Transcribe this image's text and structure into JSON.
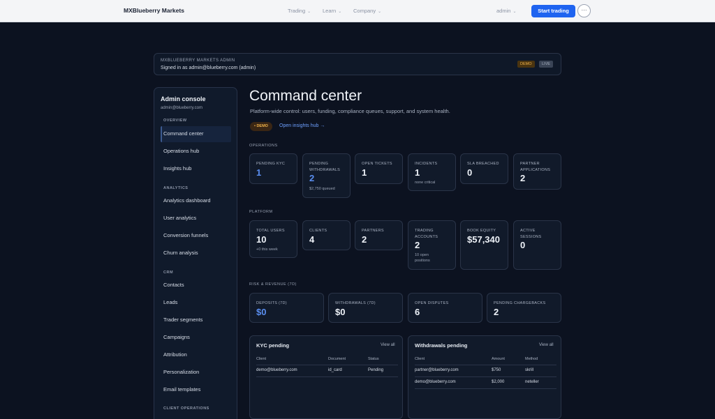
{
  "nav": {
    "brand": "MXBlueberry Markets",
    "links": [
      "Trading",
      "Learn",
      "Company"
    ],
    "user": "admin",
    "cta": "Start trading",
    "more": "···"
  },
  "banner": {
    "kicker": "MXBLUEBERRY MARKETS ADMIN",
    "signed_in": "Signed in as admin@blueberry.com (admin)",
    "demo_badge": "DEMO",
    "live_badge": "LIVE"
  },
  "sidebar": {
    "title": "Admin console",
    "email": "admin@blueberry.com",
    "sections": [
      {
        "label": "OVERVIEW",
        "items": [
          "Command center",
          "Operations hub",
          "Insights hub"
        ]
      },
      {
        "label": "ANALYTICS",
        "items": [
          "Analytics dashboard",
          "User analytics",
          "Conversion funnels",
          "Churn analysis"
        ]
      },
      {
        "label": "CRM",
        "items": [
          "Contacts",
          "Leads",
          "Trader segments",
          "Campaigns",
          "Attribution",
          "Personalization",
          "Email templates"
        ]
      },
      {
        "label": "CLIENT OPERATIONS",
        "items": []
      }
    ],
    "active_item": "Command center"
  },
  "main": {
    "title": "Command center",
    "subtitle": "Platform-wide control: users, funding, compliance queues, support, and system health.",
    "demo_pill": "• DEMO",
    "insights_link": "Open insights hub →",
    "operations": {
      "label": "OPERATIONS",
      "cards": [
        {
          "label": "PENDING KYC",
          "value": "1",
          "note": "",
          "blue": true
        },
        {
          "label": "PENDING WITHDRAWALS",
          "value": "2",
          "note": "$2,750 queued",
          "blue": true
        },
        {
          "label": "OPEN TICKETS",
          "value": "1",
          "note": "",
          "blue": false
        },
        {
          "label": "INCIDENTS",
          "value": "1",
          "note": "none critical",
          "blue": false
        },
        {
          "label": "SLA BREACHED",
          "value": "0",
          "note": "",
          "blue": false
        },
        {
          "label": "PARTNER APPLICATIONS",
          "value": "2",
          "note": "",
          "blue": false
        }
      ]
    },
    "platform": {
      "label": "PLATFORM",
      "cards": [
        {
          "label": "TOTAL USERS",
          "value": "10",
          "note": "+0 this week"
        },
        {
          "label": "CLIENTS",
          "value": "4",
          "note": ""
        },
        {
          "label": "PARTNERS",
          "value": "2",
          "note": ""
        },
        {
          "label": "TRADING ACCOUNTS",
          "value": "2",
          "note": "10 open positions"
        },
        {
          "label": "BOOK EQUITY",
          "value": "$57,340",
          "note": ""
        },
        {
          "label": "ACTIVE SESSIONS",
          "value": "0",
          "note": ""
        }
      ]
    },
    "risk": {
      "label": "RISK & REVENUE (7D)",
      "cards": [
        {
          "label": "DEPOSITS (7D)",
          "value": "$0",
          "blue": true
        },
        {
          "label": "WITHDRAWALS (7D)",
          "value": "$0",
          "blue": false
        },
        {
          "label": "OPEN DISPUTES",
          "value": "6",
          "blue": false
        },
        {
          "label": "PENDING CHARGEBACKS",
          "value": "2",
          "blue": false
        }
      ]
    },
    "kyc_table": {
      "title": "KYC pending",
      "view_all": "View all",
      "columns": [
        "Client",
        "Document",
        "Status"
      ],
      "rows": [
        [
          "demo@blueberry.com",
          "id_card",
          "Pending"
        ]
      ]
    },
    "withdrawals_table": {
      "title": "Withdrawals pending",
      "view_all": "View all",
      "columns": [
        "Client",
        "Amount",
        "Method"
      ],
      "rows": [
        [
          "partner@blueberry.com",
          "$750",
          "skrill"
        ],
        [
          "demo@blueberry.com",
          "$2,000",
          "neteller"
        ]
      ]
    }
  }
}
